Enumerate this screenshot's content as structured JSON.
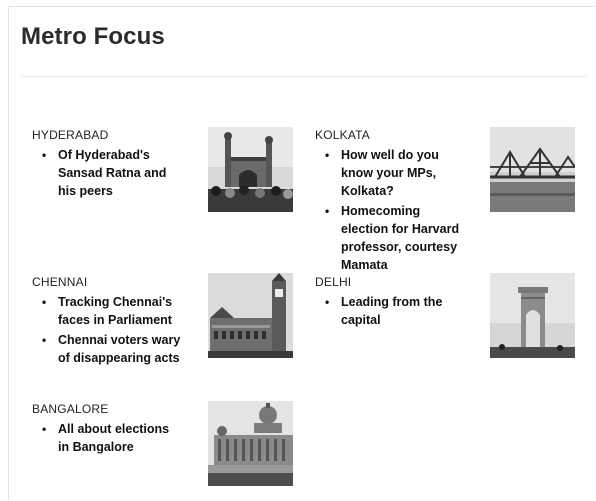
{
  "section": {
    "title": "Metro Focus"
  },
  "cities": [
    {
      "name": "HYDERABAD",
      "stories": [
        "Of Hyderabad's Sansad Ratna and his peers"
      ],
      "image_icon": "charminar-photo"
    },
    {
      "name": "KOLKATA",
      "stories": [
        "How well do you know your MPs, Kolkata?",
        "Homecoming election for Harvard professor, courtesy Mamata"
      ],
      "image_icon": "howrah-bridge-photo"
    },
    {
      "name": "CHENNAI",
      "stories": [
        "Tracking Chennai's faces in Parliament",
        "Chennai voters wary of disappearing acts"
      ],
      "image_icon": "chennai-central-photo"
    },
    {
      "name": "DELHI",
      "stories": [
        "Leading from the capital"
      ],
      "image_icon": "india-gate-photo"
    },
    {
      "name": "BANGALORE",
      "stories": [
        "All about elections in Bangalore"
      ],
      "image_icon": "vidhana-soudha-photo"
    }
  ]
}
